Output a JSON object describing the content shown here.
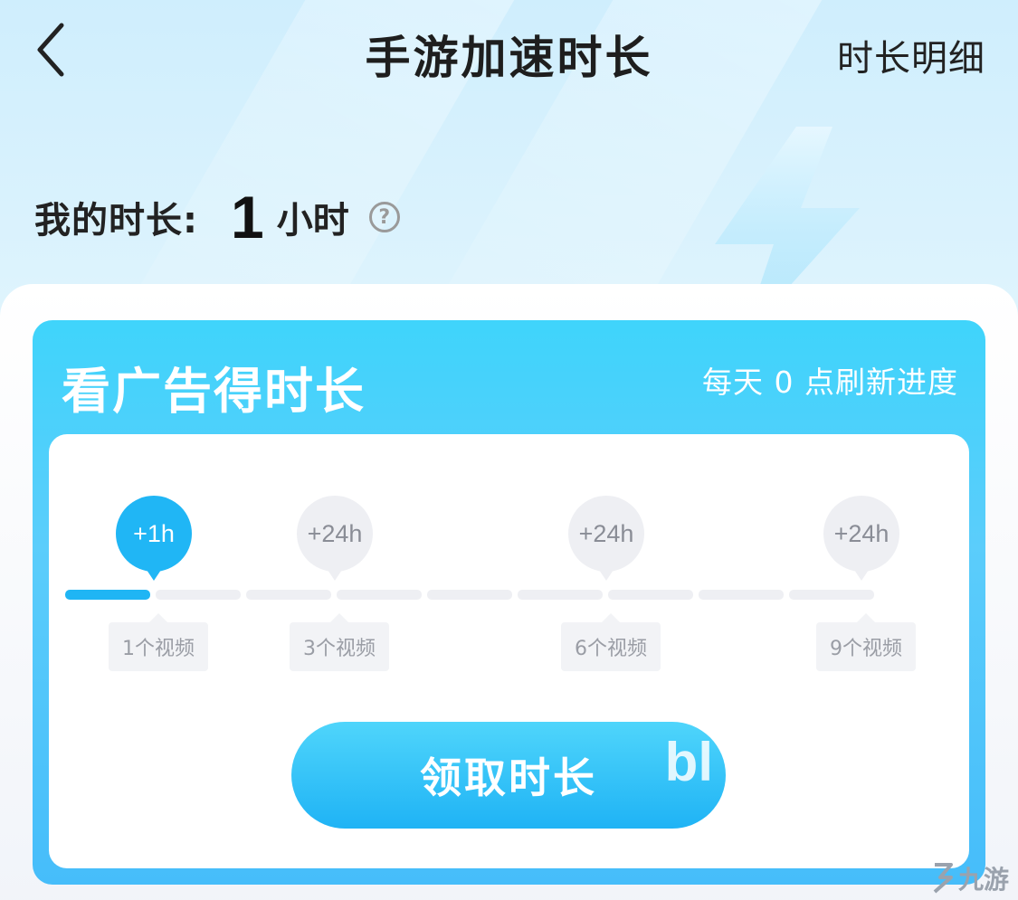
{
  "header": {
    "title": "手游加速时长",
    "detail_link": "时长明细",
    "back_icon": "chevron-left-icon"
  },
  "balance": {
    "label": "我的时长:",
    "value": "1",
    "unit": "小时",
    "help_icon": "?"
  },
  "ad_task": {
    "title": "看广告得时长",
    "refresh_hint": "每天 0 点刷新进度",
    "milestones": [
      {
        "reward": "+1h",
        "videos": "1个视频",
        "active": true
      },
      {
        "reward": "+24h",
        "videos": "3个视频",
        "active": false
      },
      {
        "reward": "+24h",
        "videos": "6个视频",
        "active": false
      },
      {
        "reward": "+24h",
        "videos": "9个视频",
        "active": false
      }
    ],
    "progress": {
      "completed_segments": 1,
      "total_segments": 9
    },
    "claim_button": "领取时长",
    "claim_badge": "bl"
  },
  "watermark": {
    "text": "九游"
  },
  "colors": {
    "accent": "#1fb5f4",
    "card_top": "#3fd4fb",
    "inactive": "#eeeff3",
    "muted_text": "#9a9da5"
  }
}
